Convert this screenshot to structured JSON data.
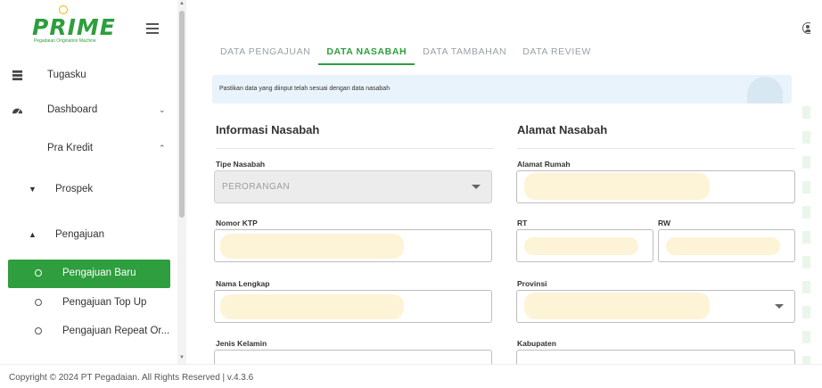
{
  "brand": {
    "name": "PRIME",
    "tagline": "Pegadaian Origination Machine"
  },
  "sidebar": {
    "items": [
      {
        "label": "Tugasku",
        "icon": "task-list-icon"
      },
      {
        "label": "Dashboard",
        "icon": "dashboard-gauge-icon"
      },
      {
        "label": "Pra Kredit"
      }
    ],
    "sub_groups": [
      {
        "label": "Prospek"
      },
      {
        "label": "Pengajuan"
      }
    ],
    "leaves": [
      {
        "label": "Pengajuan Baru",
        "active": true
      },
      {
        "label": "Pengajuan Top Up"
      },
      {
        "label": "Pengajuan Repeat Or..."
      }
    ]
  },
  "tabs": [
    "DATA PENGAJUAN",
    "DATA NASABAH",
    "DATA TAMBAHAN",
    "DATA REVIEW"
  ],
  "active_tab": "DATA NASABAH",
  "notice": "Pastikan data yang diinput telah sesuai dengan data nasabah",
  "left_section": {
    "title": "Informasi Nasabah",
    "fields": {
      "tipe_label": "Tipe Nasabah",
      "tipe_value": "PERORANGAN",
      "ktp_label": "Nomor KTP",
      "nama_label": "Nama Lengkap",
      "jk_label": "Jenis Kelamin"
    }
  },
  "right_section": {
    "title": "Alamat Nasabah",
    "fields": {
      "alamat_label": "Alamat Rumah",
      "rt_label": "RT",
      "rw_label": "RW",
      "provinsi_label": "Provinsi",
      "kabupaten_label": "Kabupaten"
    }
  },
  "footer": "Copyright © 2024 PT Pegadaian. All Rights Reserved | v.4.3.6",
  "colors": {
    "brand_green": "#2e9e3e",
    "notice_bg": "#e8f3fb",
    "redaction": "#fdf3d6"
  }
}
